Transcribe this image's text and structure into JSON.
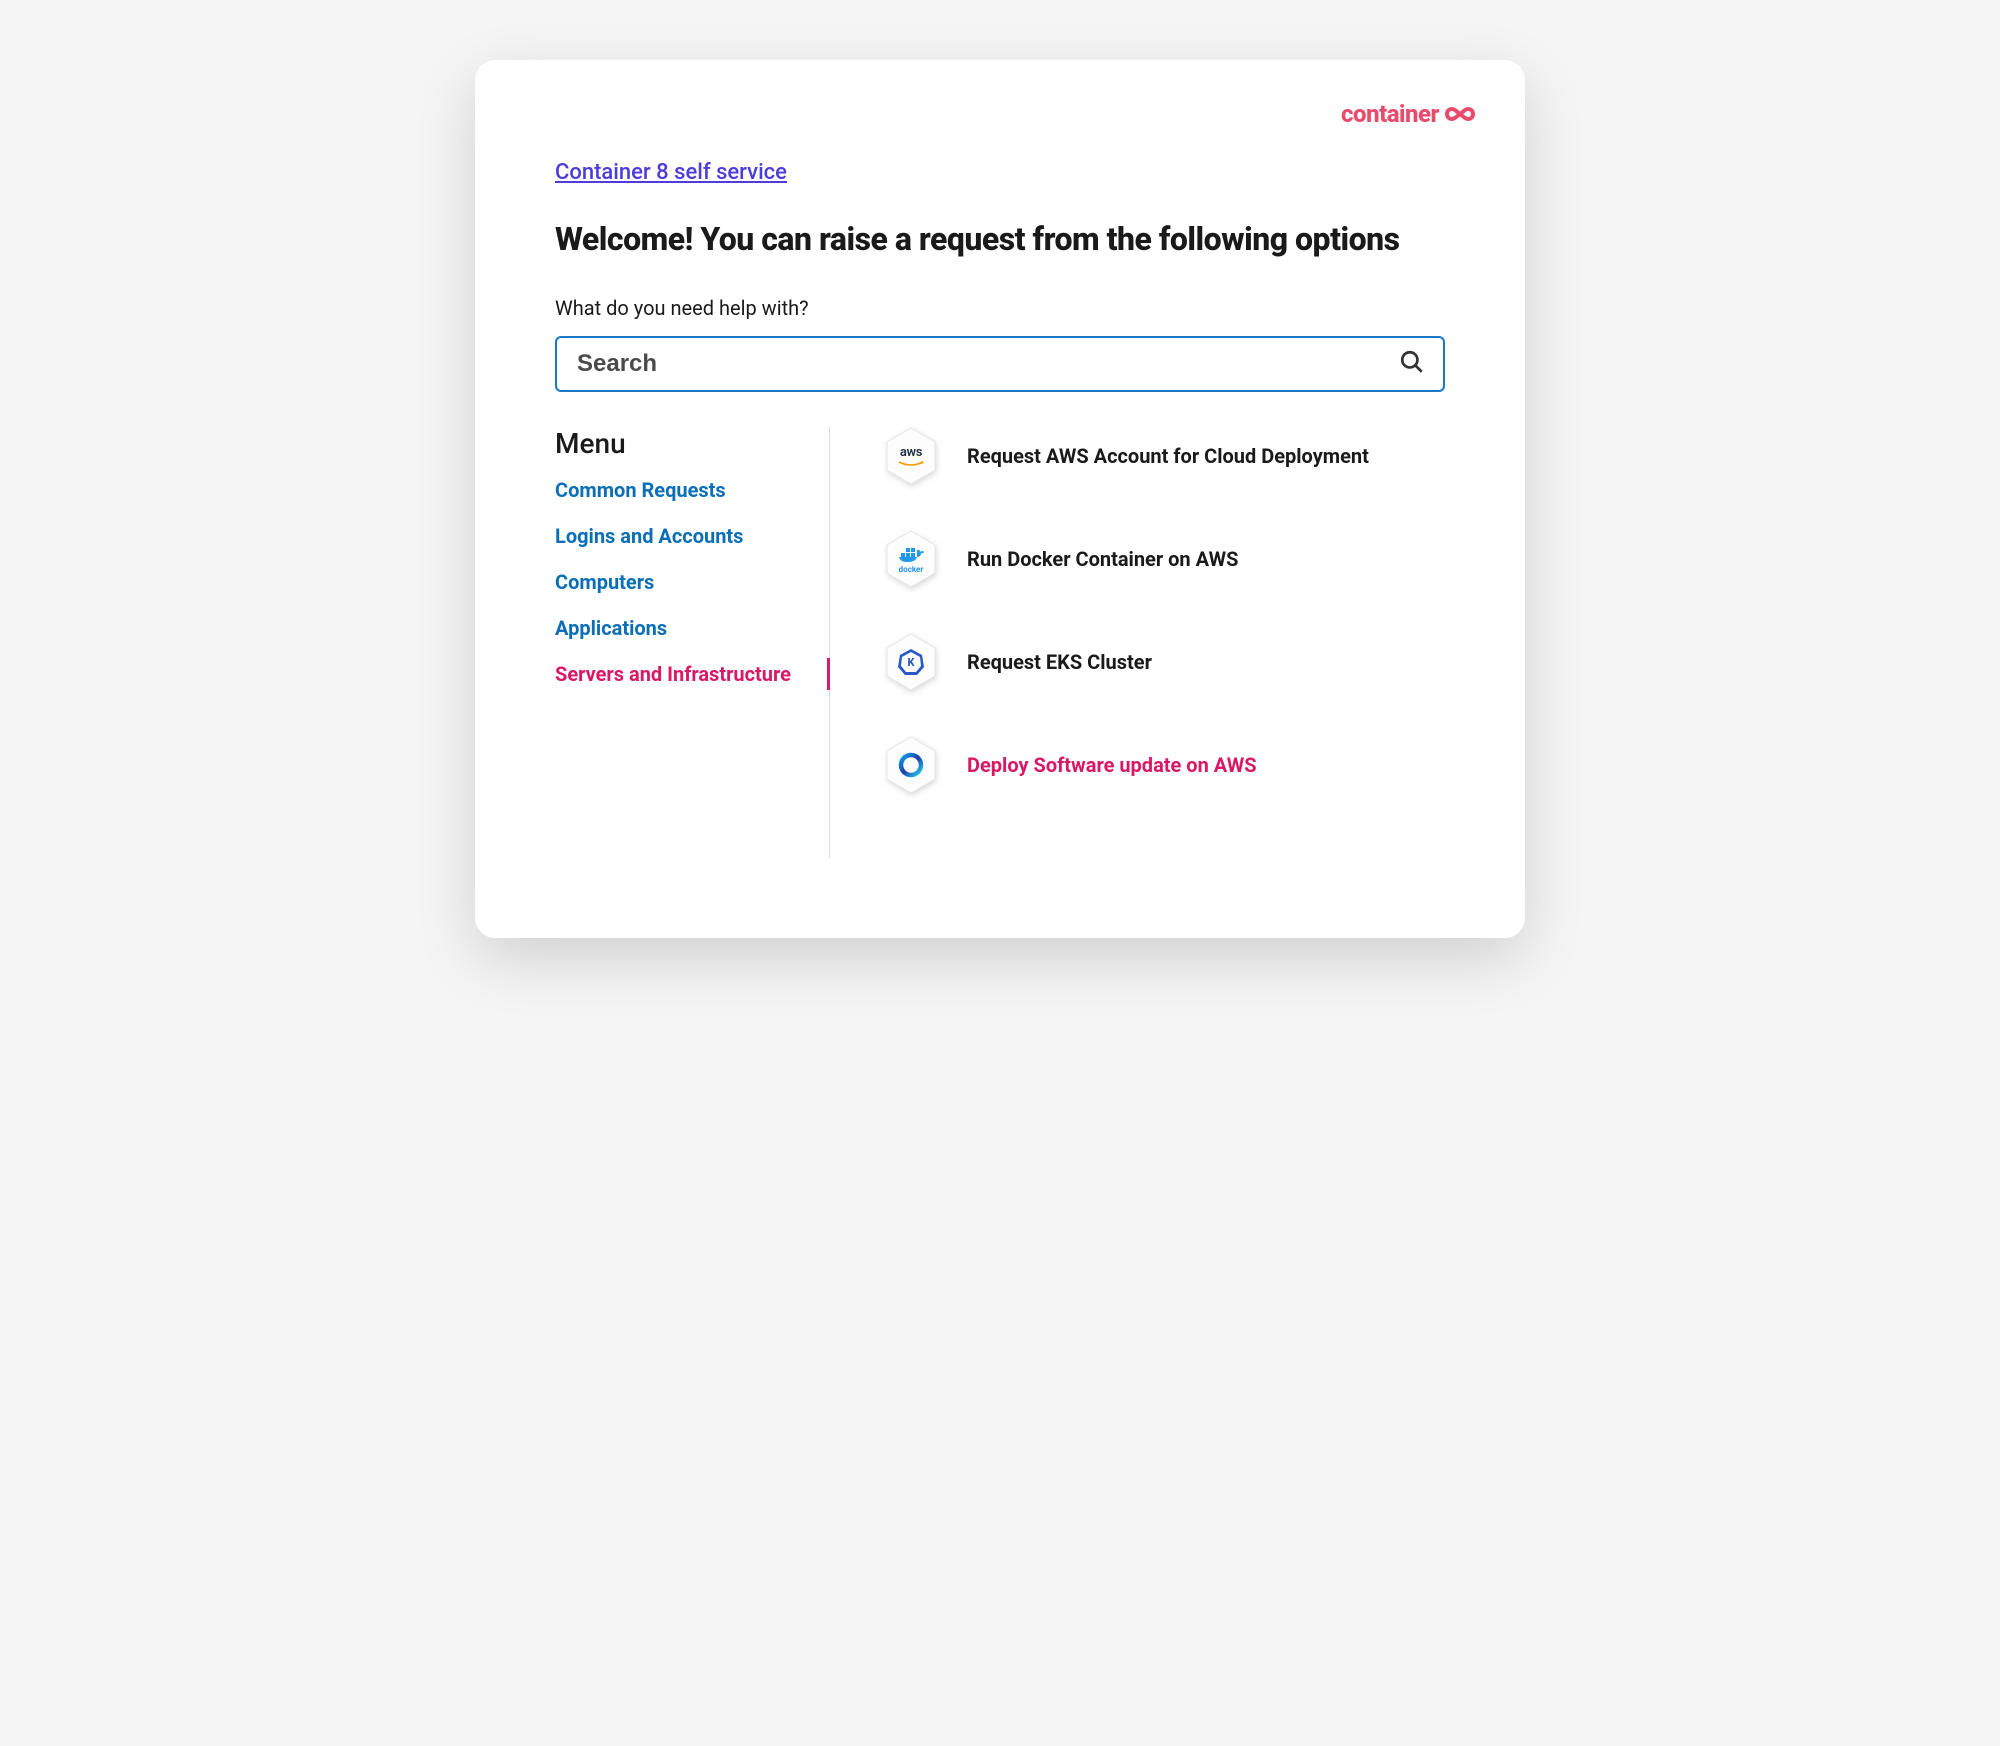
{
  "brand": {
    "name": "container"
  },
  "breadcrumb": "Container 8 self service",
  "welcome_title": "Welcome! You can raise a request from the following options",
  "help_label": "What do you need help with?",
  "search": {
    "placeholder": "Search"
  },
  "menu": {
    "title": "Menu",
    "items": [
      {
        "label": "Common Requests",
        "active": false
      },
      {
        "label": "Logins and Accounts",
        "active": false
      },
      {
        "label": "Computers",
        "active": false
      },
      {
        "label": "Applications",
        "active": false
      },
      {
        "label": "Servers and Infrastructure",
        "active": true
      }
    ]
  },
  "requests": [
    {
      "label": "Request AWS Account for Cloud Deployment",
      "icon": "aws",
      "highlighted": false
    },
    {
      "label": "Run Docker Container on AWS",
      "icon": "docker",
      "highlighted": false
    },
    {
      "label": "Request EKS Cluster",
      "icon": "kubernetes",
      "highlighted": false
    },
    {
      "label": "Deploy Software update on AWS",
      "icon": "ring",
      "highlighted": true
    }
  ],
  "colors": {
    "link": "#4b3cdb",
    "menu": "#0b6fb8",
    "accent": "#d91866",
    "brand": "#e94b6c",
    "search_border": "#1c78c0"
  }
}
